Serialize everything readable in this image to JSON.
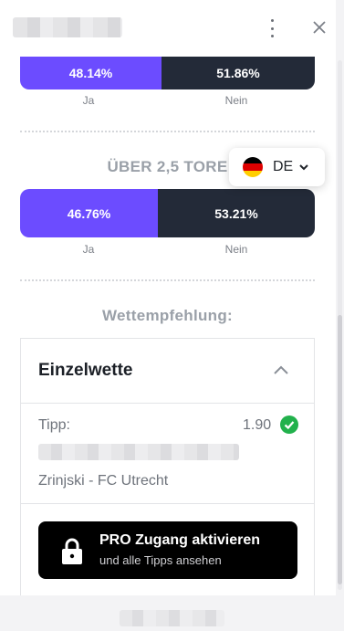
{
  "market1": {
    "yes_pct": "48.14%",
    "no_pct": "51.86%",
    "yes_value": 48.14,
    "no_value": 51.86,
    "yes_label": "Ja",
    "no_label": "Nein"
  },
  "market2": {
    "title": "ÜBER 2,5 TORE",
    "yes_pct": "46.76%",
    "no_pct": "53.21%",
    "yes_value": 46.76,
    "no_value": 53.21,
    "yes_label": "Ja",
    "no_label": "Nein"
  },
  "language": {
    "code": "DE",
    "flag_colors": [
      "#000000",
      "#dd0000",
      "#ffce00"
    ]
  },
  "recommendation": {
    "heading": "Wettempfehlung:",
    "card_title": "Einzelwette",
    "tip_label": "Tipp:",
    "odds": "1.90",
    "match": "Zrinjski - FC Utrecht",
    "pro_button": {
      "title": "PRO Zugang aktivieren",
      "subtitle": "und alle Tipps ansehen"
    }
  },
  "colors": {
    "accent": "#6c4cff",
    "dark": "#232a38",
    "success": "#22b14c"
  }
}
